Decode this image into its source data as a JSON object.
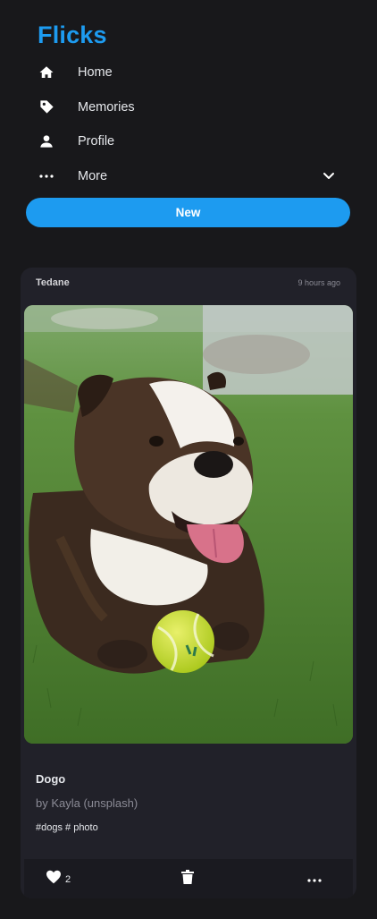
{
  "app": {
    "brand": "Flicks"
  },
  "nav": {
    "items": [
      {
        "label": "Home",
        "icon": "home-icon"
      },
      {
        "label": "Memories",
        "icon": "tag-icon"
      },
      {
        "label": "Profile",
        "icon": "user-icon"
      },
      {
        "label": "More",
        "icon": "more-horizontal-icon",
        "trailing_icon": "chevron-down-icon"
      }
    ]
  },
  "new_button": {
    "label": "New"
  },
  "post": {
    "author": "Tedane",
    "time": "9 hours ago",
    "image_description": "bulldog-on-grass-with-tennis-ball",
    "title": "Dogo",
    "byline": "by Kayla (unsplash)",
    "tags": "#dogs # photo",
    "likes": "2",
    "footer_icons": [
      "heart-icon",
      "trash-icon",
      "more-horizontal-icon"
    ]
  },
  "colors": {
    "background": "#18181b",
    "card": "#212129",
    "accent": "#1d9bf0"
  }
}
